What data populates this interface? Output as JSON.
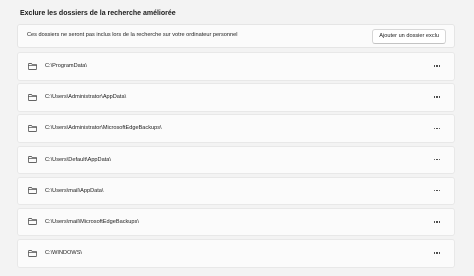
{
  "section": {
    "title": "Exclure les dossiers de la recherche améliorée"
  },
  "header": {
    "description": "Ces dossiers ne seront pas inclus lors de la recherche sur votre ordinateur personnel",
    "add_button_label": "Ajouter un dossier exclu"
  },
  "folders": [
    {
      "path": "C:\\ProgramData\\",
      "icon": "folder-icon",
      "menu_icon": "more-options-icon"
    },
    {
      "path": "C:\\Users\\Administrator\\AppData\\",
      "icon": "folder-icon",
      "menu_icon": "more-options-icon"
    },
    {
      "path": "C:\\Users\\Administrator\\MicrosoftEdgeBackups\\",
      "icon": "folder-icon",
      "menu_icon": "more-options-icon"
    },
    {
      "path": "C:\\Users\\Default\\AppData\\",
      "icon": "folder-icon",
      "menu_icon": "more-options-icon"
    },
    {
      "path": "C:\\Users\\mail\\AppData\\",
      "icon": "folder-icon",
      "menu_icon": "more-options-icon"
    },
    {
      "path": "C:\\Users\\mail\\MicrosoftEdgeBackups\\",
      "icon": "folder-icon",
      "menu_icon": "more-options-icon"
    },
    {
      "path": "C:\\WINDOWS\\",
      "icon": "folder-icon",
      "menu_icon": "more-options-icon"
    }
  ],
  "colors": {
    "background": "#f3f3f3",
    "card": "#fbfbfb",
    "text": "#1b1b1b"
  }
}
